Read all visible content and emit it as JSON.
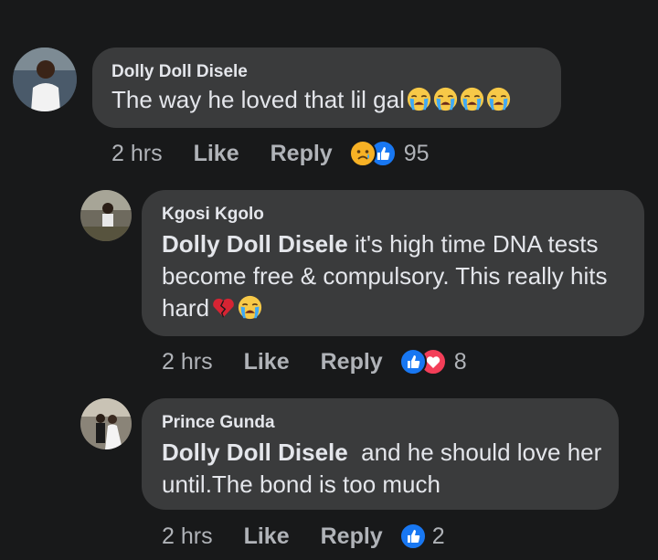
{
  "comments": [
    {
      "author": "Dolly Doll Disele",
      "mention": "",
      "text": "The way he loved that lil gal",
      "emoji": "loudly-crying-face x4",
      "time": "2 hrs",
      "like_label": "Like",
      "reply_label": "Reply",
      "reactions": [
        "sad-react-icon",
        "like-react-icon"
      ],
      "reaction_count": "95"
    },
    {
      "author": "Kgosi Kgolo",
      "mention": "Dolly Doll Disele",
      "text_line1": " it's high time DNA tests",
      "text_line2": "become free & compulsory. This really hits",
      "text_line3": "hard",
      "emoji": "broken-heart, loudly-crying-face",
      "time": "2 hrs",
      "like_label": "Like",
      "reply_label": "Reply",
      "reactions": [
        "like-react-icon",
        "love-react-icon"
      ],
      "reaction_count": "8"
    },
    {
      "author": "Prince Gunda",
      "mention": "Dolly Doll Disele",
      "text_line1": "  and he should love her",
      "text_line2": "until.The bond is too much",
      "time": "2 hrs",
      "like_label": "Like",
      "reply_label": "Reply",
      "reactions": [
        "like-react-icon"
      ],
      "reaction_count": "2"
    }
  ],
  "colors": {
    "background": "#18191a",
    "bubble": "#3a3b3c",
    "text": "#e4e6eb",
    "secondary": "#b0b3b8",
    "like_blue": "#1877f2",
    "love_red": "#f33e58",
    "sad_yellow": "#f7b125"
  }
}
